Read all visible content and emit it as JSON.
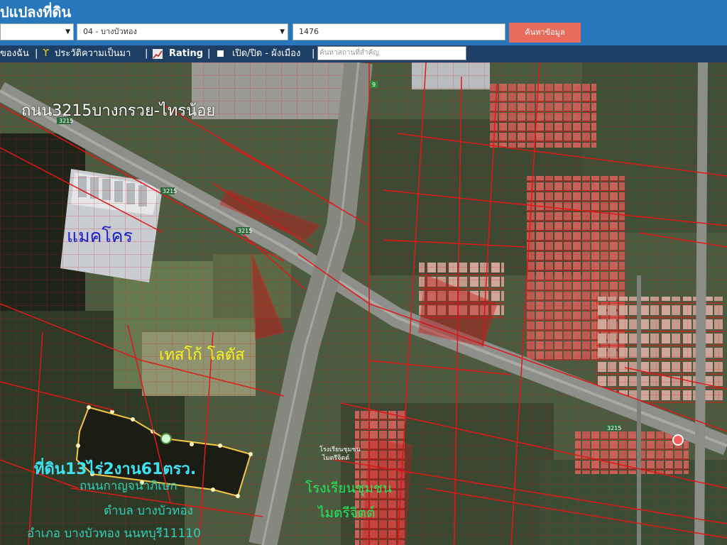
{
  "header": {
    "title": "ปแปลงที่ดิน",
    "district_value": "04 - บางบัวทอง",
    "parcel_value": "1476",
    "search_button": "ค้นหาข้อมูล"
  },
  "toolbar": {
    "item1": "ของฉัน",
    "sep": "|",
    "history": "ประวัติความเป็นมา",
    "rating": "Rating",
    "toggle": "เปิด/ปิด - ผังเมือง",
    "place_placeholder": "ค้นหาสถานที่สำคัญ"
  },
  "map": {
    "labels": {
      "road": "ถนน3215บางกรวย-ไทรน้อย",
      "makro": "แมคโคร",
      "lotus": "เทสโก้ โลตัส",
      "parcel": "ที่ดิน13ไร่2งาน61ตรว.",
      "road2": "ถนนกาญจนาภิเษก",
      "tambon": "ตำบล บางบัวทอง",
      "amphoe": "อำเภอ บางบัวทอง นนทบุรี11110",
      "school": "โรงเรียนชุมชน",
      "school2": "ไมตรีจิตต์"
    },
    "road_signs": [
      "3215",
      "3215",
      "3215",
      "3215",
      "9"
    ],
    "school_small": "โรงเรียนชุมชน",
    "school_small2": "ไมตรีจิตต์"
  },
  "colors": {
    "header": "#2877bd",
    "toolbar": "#1d3f66",
    "search_button": "#e86b5b",
    "parcel_lines": "#e01818"
  }
}
